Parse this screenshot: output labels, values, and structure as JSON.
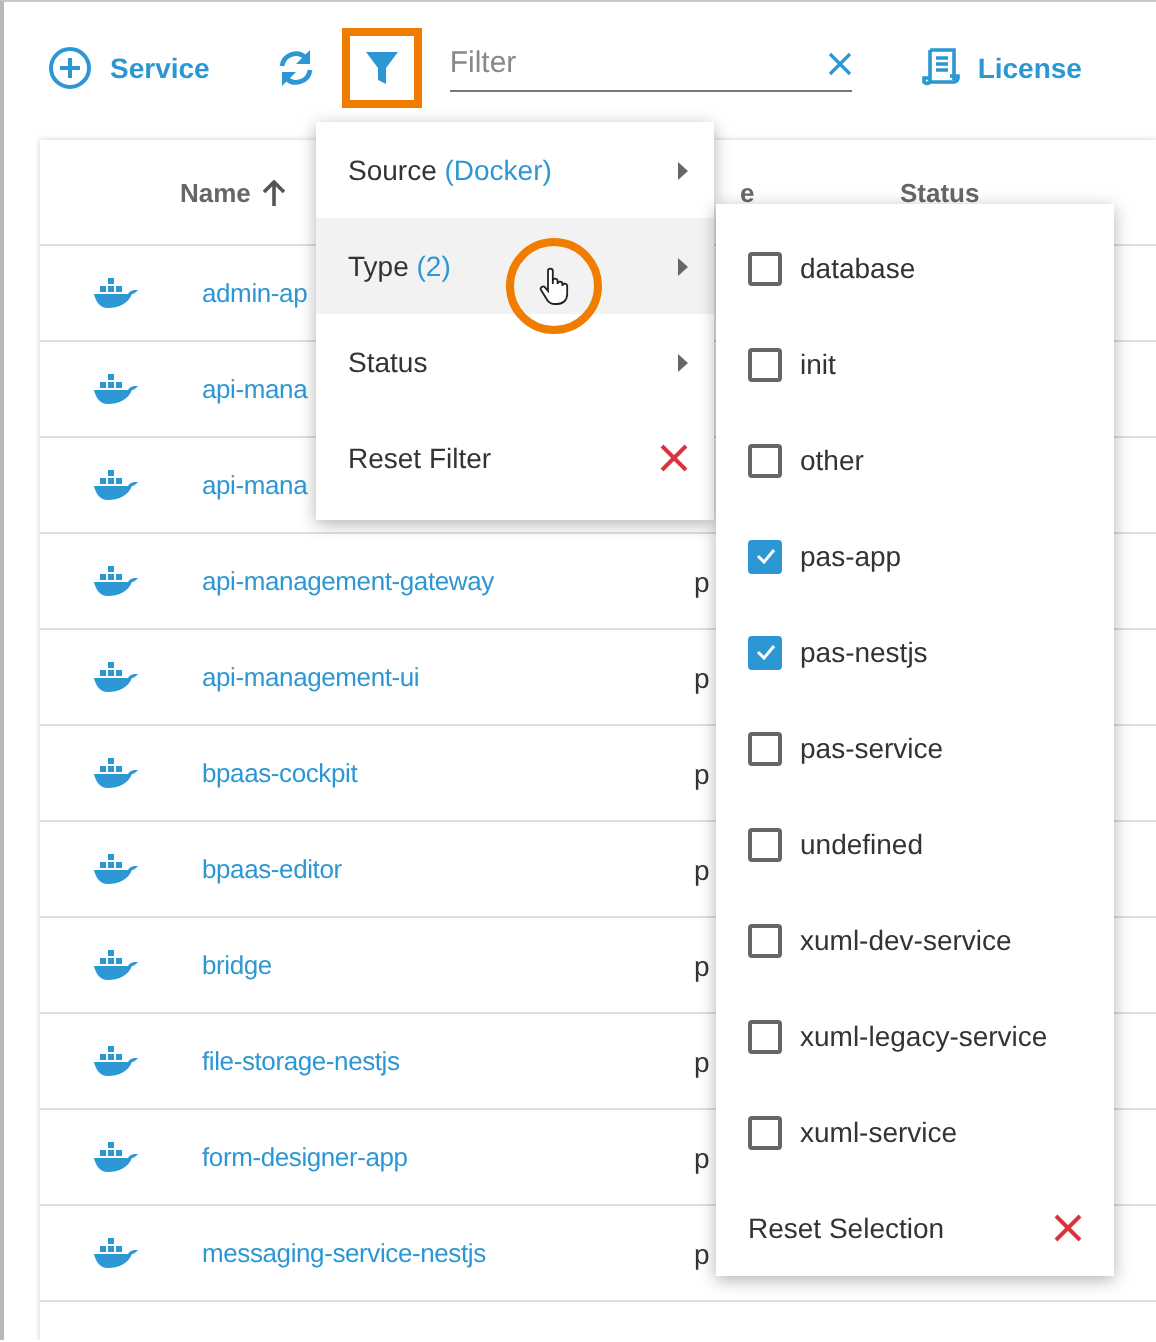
{
  "toolbar": {
    "add_button": {
      "label": "Service"
    },
    "filter_button": {
      "highlighted": true
    },
    "search": {
      "placeholder": "Filter"
    },
    "license_button": {
      "label": "License"
    }
  },
  "table": {
    "columns": [
      {
        "label": "Name",
        "sorted": true
      },
      {
        "label": "e"
      },
      {
        "label": "Status"
      }
    ],
    "rows": [
      {
        "name": "admin-ap"
      },
      {
        "name": "api-mana"
      },
      {
        "name": "api-mana"
      },
      {
        "name": "api-management-gateway",
        "type": "p"
      },
      {
        "name": "api-management-ui",
        "type": "p"
      },
      {
        "name": "bpaas-cockpit",
        "type": "p"
      },
      {
        "name": "bpaas-editor",
        "type": "p"
      },
      {
        "name": "bridge",
        "type": "p"
      },
      {
        "name": "file-storage-nestjs",
        "type": "p"
      },
      {
        "name": "form-designer-app",
        "type": "p"
      },
      {
        "name": "messaging-service-nestjs",
        "type": "p"
      }
    ]
  },
  "filter_menu": {
    "items": [
      {
        "kind": "submenu",
        "label": "Source",
        "value": "(Docker)",
        "selected": false
      },
      {
        "kind": "submenu",
        "label": "Type",
        "value": "(2)",
        "selected": true
      },
      {
        "kind": "submenu",
        "label": "Status",
        "selected": false
      },
      {
        "kind": "reset",
        "label": "Reset Filter",
        "selected": false
      }
    ]
  },
  "type_submenu": {
    "options": [
      {
        "label": "database",
        "checked": false
      },
      {
        "label": "init",
        "checked": false
      },
      {
        "label": "other",
        "checked": false
      },
      {
        "label": "pas-app",
        "checked": true
      },
      {
        "label": "pas-nestjs",
        "checked": true
      },
      {
        "label": "pas-service",
        "checked": false
      },
      {
        "label": "undefined",
        "checked": false
      },
      {
        "label": "xuml-dev-service",
        "checked": false
      },
      {
        "label": "xuml-legacy-service",
        "checked": false
      },
      {
        "label": "xuml-service",
        "checked": false
      }
    ],
    "reset": "Reset Selection"
  }
}
